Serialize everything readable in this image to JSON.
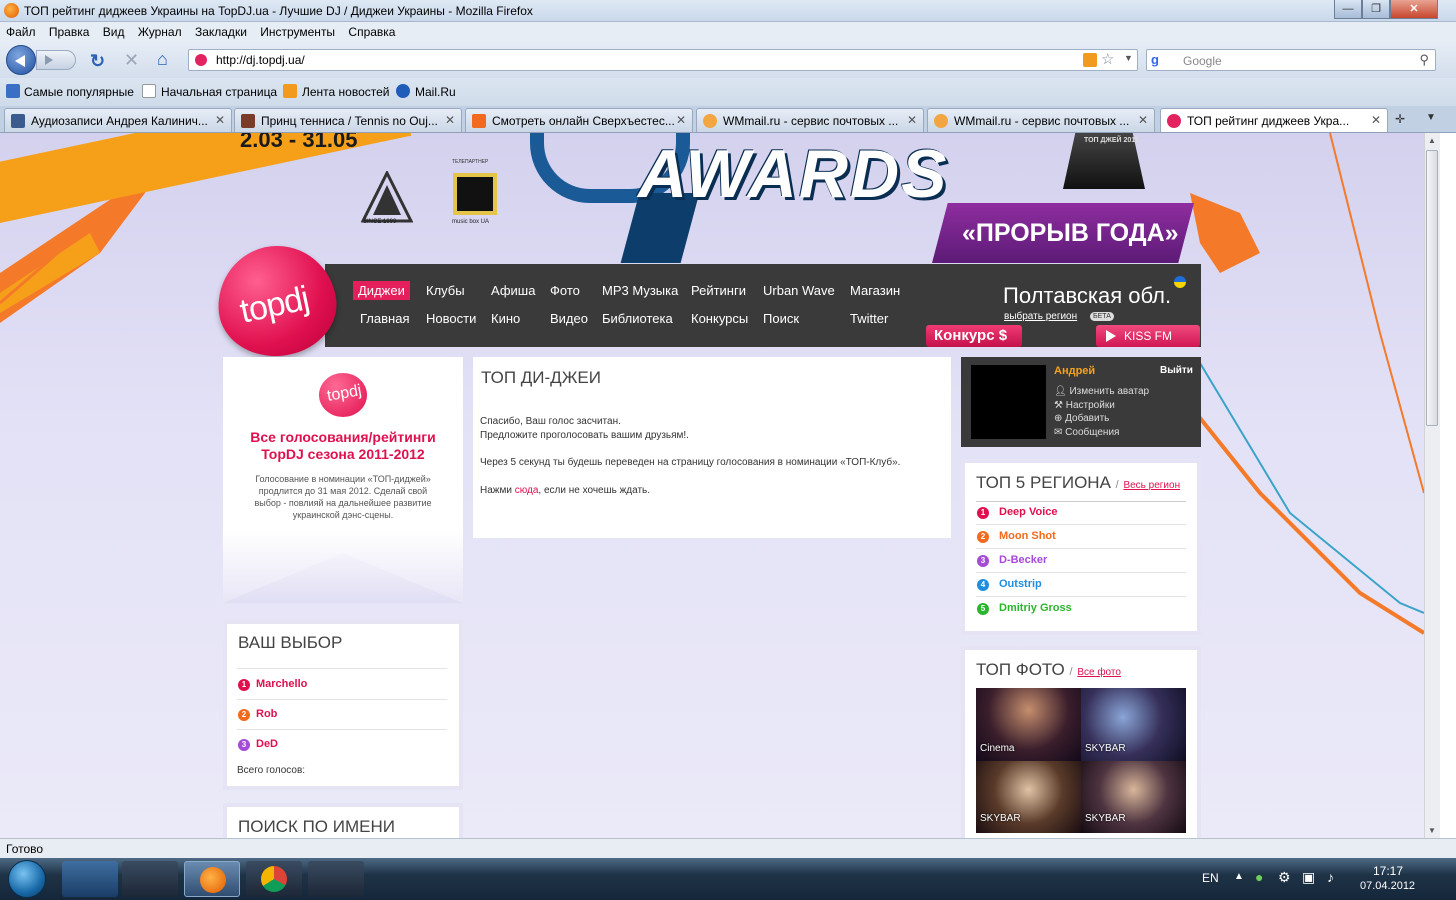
{
  "window": {
    "title": "ТОП рейтинг диджеев Украины на TopDJ.ua - Лучшие DJ / Диджеи Украины - Mozilla Firefox",
    "min_label": "—",
    "max_label": "❐",
    "close_label": "✕"
  },
  "menu": [
    "Файл",
    "Правка",
    "Вид",
    "Журнал",
    "Закладки",
    "Инструменты",
    "Справка"
  ],
  "nav": {
    "url": "http://dj.topdj.ua/",
    "search_placeholder": "Google",
    "search_icon": "search-icon",
    "back_icon": "back-arrow-icon",
    "forward_icon": "forward-arrow-icon"
  },
  "bookmarks": [
    {
      "label": "Самые популярные",
      "icon_color": "#3b6fc6"
    },
    {
      "label": "Начальная страница",
      "icon_color": "#ffffff"
    },
    {
      "label": "Лента новостей",
      "icon_color": "#f29a1d"
    },
    {
      "label": "Mail.Ru",
      "icon_color": "#1f5db8"
    }
  ],
  "tabs": [
    {
      "label": "Аудиозаписи Андрея Калинич...",
      "icon_color": "#3b5b8e",
      "active": false
    },
    {
      "label": "Принц тенниса / Tennis no Ouj...",
      "icon_color": "#7a3b2b",
      "active": false
    },
    {
      "label": "Смотреть онлайн Сверхъестес...",
      "icon_color": "#f26a1d",
      "active": false
    },
    {
      "label": "WMmail.ru - сервис почтовых ...",
      "icon_color": "#f2a541",
      "active": false
    },
    {
      "label": "WMmail.ru - сервис почтовых ...",
      "icon_color": "#f2a541",
      "active": false
    },
    {
      "label": "ТОП рейтинг диджеев Укра...",
      "icon_color": "#e2235f",
      "active": true
    }
  ],
  "banner": {
    "dates": "2.03 - 31.05",
    "awards": "AWARDS",
    "proryv": "«ПРОРЫВ ГОДА»",
    "logo1_sub": "SINCE 1999",
    "partner_label": "ТЕЛЕПАРТНЕР",
    "logo2_sub": "music box UA",
    "trophy_text": "ТОП ДЖЕЙ 2011"
  },
  "sitenav": {
    "row1": [
      "Диджеи",
      "Клубы",
      "Афиша",
      "Фото",
      "MP3 Музыка",
      "Рейтинги",
      "Urban Wave",
      "Магазин"
    ],
    "row2": [
      "Главная",
      "Новости",
      "Кино",
      "Видео",
      "Библиотека",
      "Конкурсы",
      "Поиск",
      "Twitter"
    ],
    "region": "Полтавская обл.",
    "region_link": "выбрать регион",
    "beta": "БЕТА",
    "konkurs": "Конкурс $",
    "kissfm": "KISS FM",
    "logo": "topdj"
  },
  "promo": {
    "logo": "topdj",
    "title": "Все голосования/рейтинги TopDJ сезона 2011-2012",
    "text": "Голосование в номинации «ТОП-диджей» продлится до 31 мая 2012. Сделай свой выбор - повлияй на дальнейшее развитие украинской дэнс-сцены."
  },
  "choice": {
    "title": "ВАШ ВЫБОР",
    "items": [
      {
        "n": "1",
        "name": "Marchello",
        "color": "#e0104f"
      },
      {
        "n": "2",
        "name": "Rob",
        "color": "#f26a1d"
      },
      {
        "n": "3",
        "name": "DeD",
        "color": "#a64ad8"
      }
    ],
    "total": "Всего голосов:"
  },
  "search": {
    "title": "ПОИСК ПО ИМЕНИ"
  },
  "center": {
    "title": "ТОП ДИ-ДЖЕИ",
    "line1": "Спасибо, Ваш голос засчитан.",
    "line2": "Предложите проголосовать вашим друзьям!.",
    "line3": "Через 5 секунд ты будешь переведен на страницу голосования в номинации «ТОП-Клуб».",
    "line4_pre": "Нажми ",
    "line4_link": "сюда",
    "line4_post": ", если не хочешь ждать."
  },
  "user": {
    "name": "Андрей",
    "logout": "Выйти",
    "options": [
      "Изменить аватар",
      "Настройки",
      "Добавить",
      "Сообщения"
    ]
  },
  "top5": {
    "title": "ТОП 5 РЕГИОНА",
    "sep": "/",
    "link": "Весь регион",
    "items": [
      {
        "n": "1",
        "name": "Deep Voice",
        "color": "#e0104f"
      },
      {
        "n": "2",
        "name": "Moon Shot",
        "color": "#f26a1d"
      },
      {
        "n": "3",
        "name": "D-Becker",
        "color": "#a64ad8"
      },
      {
        "n": "4",
        "name": "Outstrip",
        "color": "#1f8ee0"
      },
      {
        "n": "5",
        "name": "Dmitriy Gross",
        "color": "#2bb52b"
      }
    ]
  },
  "topphoto": {
    "title": "ТОП ФОТО",
    "sep": "/",
    "link": "Все фото",
    "photos": [
      "Cinema",
      "SKYBAR",
      "SKYBAR",
      "SKYBAR"
    ]
  },
  "status": "Готово",
  "taskbar": {
    "lang": "EN",
    "time": "17:17",
    "date": "07.04.2012"
  },
  "colors": {
    "accent": "#e0104f",
    "nav_bg": "#3a3a3a",
    "page_bg": "#e3e1f6"
  }
}
